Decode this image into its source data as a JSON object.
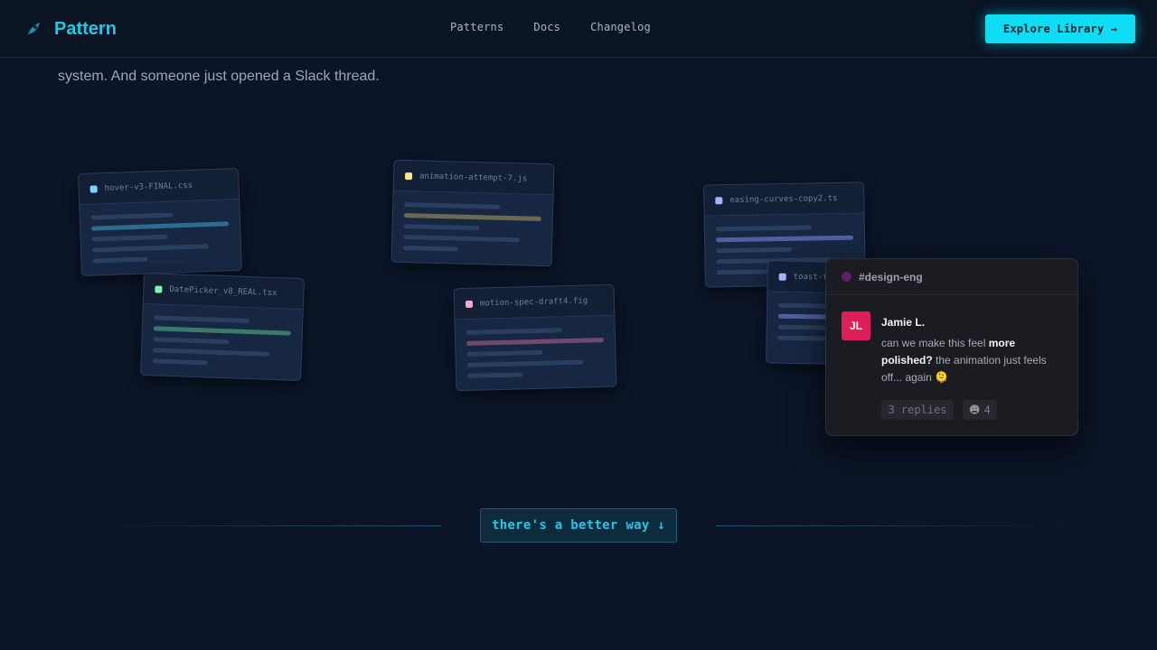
{
  "header": {
    "brand": "Pattern",
    "nav": [
      "Patterns",
      "Docs",
      "Changelog"
    ],
    "cta": "Explore Library →"
  },
  "intro_text": "system. And someone just opened a Slack thread.",
  "files": [
    {
      "name": "hover-v3-FINAL.css",
      "color": "#7dd3fc"
    },
    {
      "name": "DatePicker_v8_REAL.tsx",
      "color": "#86efac"
    },
    {
      "name": "animation-attempt-7.js",
      "color": "#fde68a"
    },
    {
      "name": "motion-spec-draft4.fig",
      "color": "#f9a8d4"
    },
    {
      "name": "easing-curves-copy2.ts",
      "color": "#a5b4fc"
    },
    {
      "name": "toast-f",
      "color": "#a5b4fc"
    }
  ],
  "slack": {
    "channel": "#design-eng",
    "avatar_initials": "JL",
    "author": "Jamie L.",
    "message_before": "can we make this feel ",
    "message_bold": "more polished?",
    "message_after": " the animation just feels off... again 🫠",
    "replies": "3 replies",
    "reaction_emoji": "😩",
    "reaction_count": "4"
  },
  "callout": "there's a better way ↓"
}
